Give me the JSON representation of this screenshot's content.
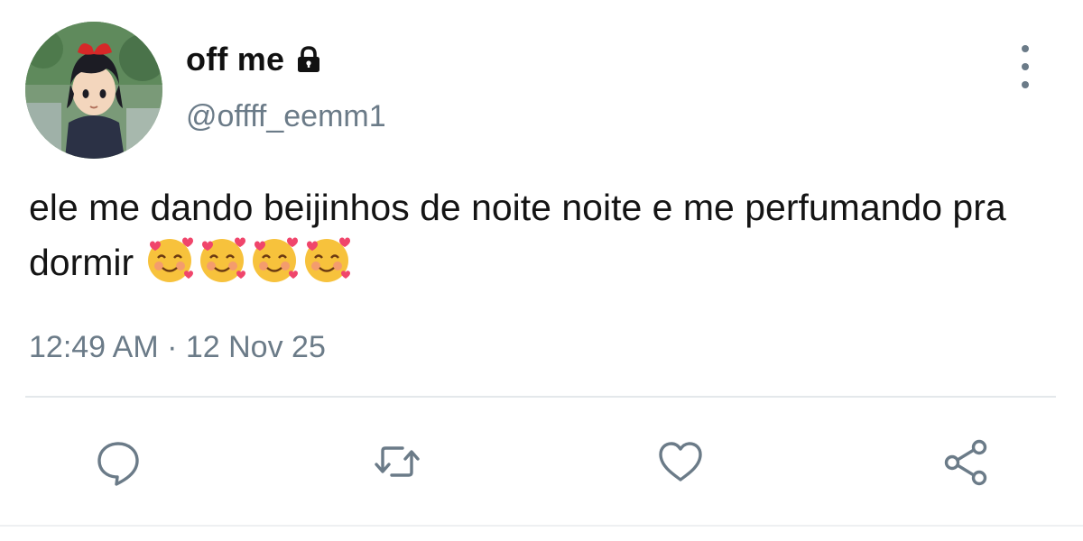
{
  "tweet": {
    "display_name": "off me",
    "handle": "@offff_eemm1",
    "protected": true,
    "text": "ele me dando beijinhos de noite noite e me perfumando pra dormir",
    "emojis": [
      "smiling-face-with-hearts",
      "smiling-face-with-hearts",
      "smiling-face-with-hearts",
      "smiling-face-with-hearts"
    ],
    "timestamp": "12:49 AM · 12 Nov 25"
  },
  "actions": [
    {
      "name": "reply",
      "icon": "speech-bubble-icon"
    },
    {
      "name": "retweet",
      "icon": "retweet-arrows-icon"
    },
    {
      "name": "like",
      "icon": "heart-icon"
    },
    {
      "name": "share",
      "icon": "share-nodes-icon"
    }
  ],
  "colors": {
    "text_primary": "#141414",
    "text_secondary": "#6b7b88",
    "divider": "#e4e8eb",
    "background": "#ffffff"
  }
}
